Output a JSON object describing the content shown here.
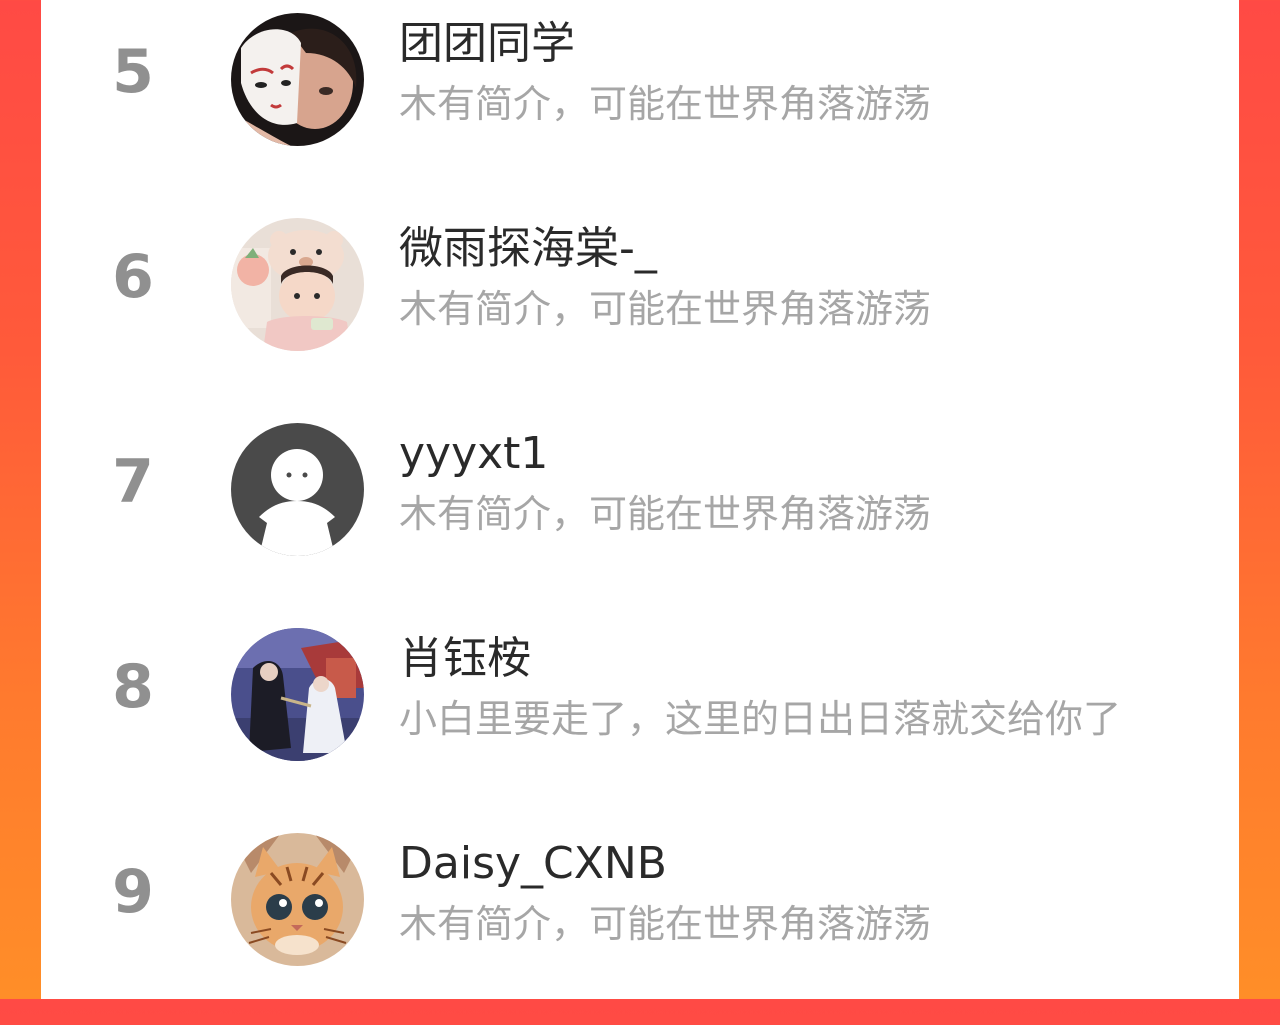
{
  "leaderboard": {
    "rows": [
      {
        "rank": "5",
        "name": "团团同学",
        "bio": "木有简介，可能在世界角落游荡",
        "avatar_icon": "masked-girl-avatar"
      },
      {
        "rank": "6",
        "name": "微雨探海棠-_",
        "bio": "木有简介，可能在世界角落游荡",
        "avatar_icon": "child-bear-hat-avatar"
      },
      {
        "rank": "7",
        "name": "yyyxt1",
        "bio": "木有简介，可能在世界角落游荡",
        "avatar_icon": "default-user-avatar"
      },
      {
        "rank": "8",
        "name": "肖钰桉",
        "bio": "小白里要走了，这里的日出日落就交给你了",
        "avatar_icon": "costume-drama-avatar"
      },
      {
        "rank": "9",
        "name": "Daisy_CXNB",
        "bio": "木有简介，可能在世界角落游荡",
        "avatar_icon": "tiger-cat-avatar"
      }
    ]
  },
  "colors": {
    "background_gradient_top": "#ff4a45",
    "background_gradient_bottom": "#ff8e28",
    "card": "#ffffff",
    "rank_text": "#909090",
    "name_text": "#2a2a2a",
    "bio_text": "#a6a6a6"
  }
}
